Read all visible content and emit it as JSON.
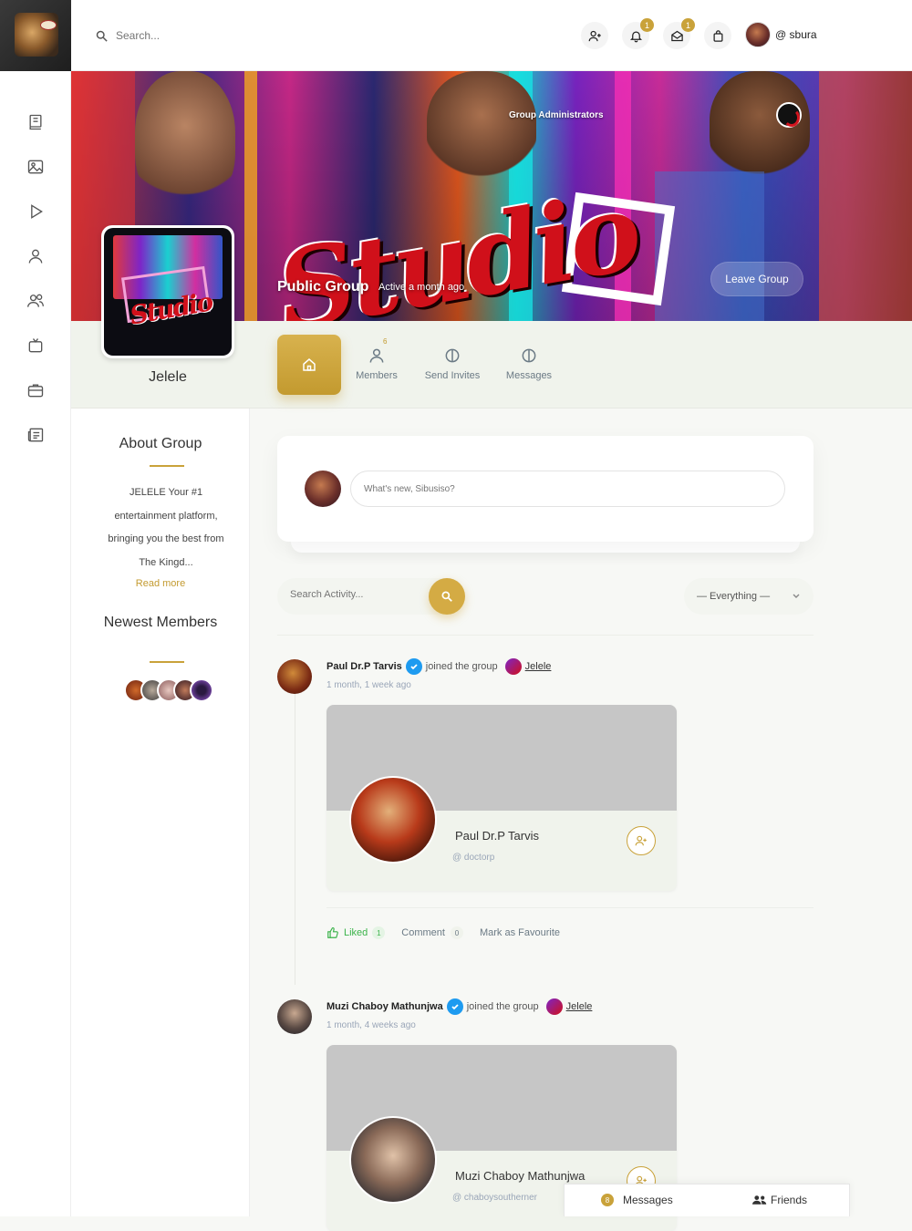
{
  "topbar": {
    "search_placeholder": "Search...",
    "notification_badge": "1",
    "messages_badge": "1",
    "username": "@ sbura"
  },
  "cover": {
    "admins_label": "Group Administrators",
    "group_type": "Public Group",
    "active": "Active a month ago",
    "leave_label": "Leave Group"
  },
  "group": {
    "name": "Jelele",
    "tabs": [
      {
        "label": "Members",
        "count": "6"
      },
      {
        "label": "Send Invites"
      },
      {
        "label": "Messages"
      }
    ]
  },
  "about": {
    "title": "About Group",
    "text": "JELELE Your #1 entertainment platform, bringing you the best from The Kingd...",
    "read_more": "Read more",
    "newest_title": "Newest Members"
  },
  "post_box": {
    "placeholder": "What's new, Sibusiso?"
  },
  "activity_filter": {
    "search_placeholder": "Search Activity...",
    "selected": "— Everything —"
  },
  "activities": [
    {
      "name": "Paul Dr.P Tarvis",
      "action": "joined the group",
      "group": "Jelele",
      "time": "1 month, 1 week ago",
      "card_name": "Paul Dr.P Tarvis",
      "card_handle": "@  doctorp",
      "liked_label": "Liked",
      "liked_count": "1",
      "comment_label": "Comment",
      "comment_count": "0",
      "favourite_label": "Mark as Favourite"
    },
    {
      "name": "Muzi Chaboy Mathunjwa",
      "action": "joined the group",
      "group": "Jelele",
      "time": "1 month, 4 weeks ago",
      "card_name": "Muzi Chaboy Mathunjwa",
      "card_handle": "@  chaboysoutherner"
    }
  ],
  "chatbar": {
    "messages_count": "8",
    "messages_label": "Messages",
    "friends_label": "Friends"
  },
  "colors": {
    "accent": "#c9a23a",
    "liked": "#3bb34a",
    "verified": "#1e9bf0"
  }
}
